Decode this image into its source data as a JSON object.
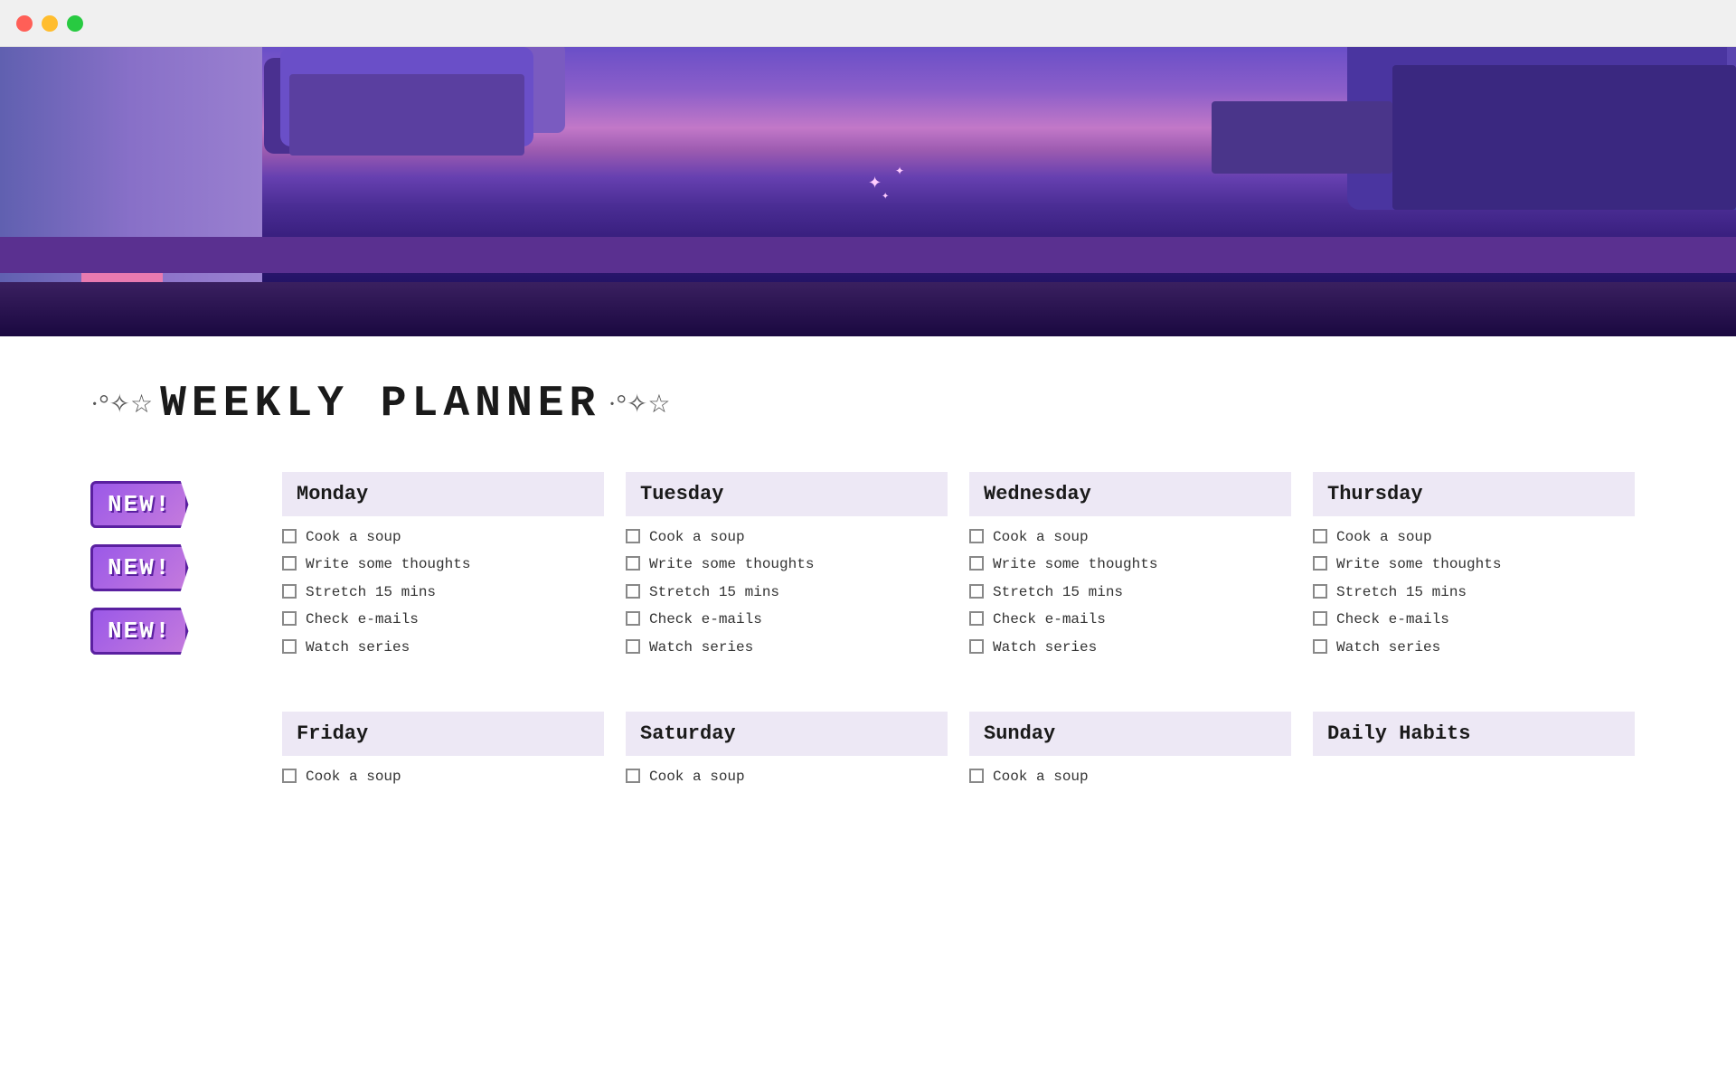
{
  "window": {
    "close_label": "close",
    "min_label": "minimize",
    "max_label": "maximize"
  },
  "title": {
    "deco_left": "·°✧☆",
    "main": "WEEKLY PLANNER",
    "deco_right": "·°✧☆"
  },
  "badges": [
    "NEW!",
    "NEW!",
    "NEW!"
  ],
  "days": [
    {
      "name": "Monday",
      "tasks": [
        "Cook a soup",
        "Write some thoughts",
        "Stretch 15 mins",
        "Check e-mails",
        "Watch series"
      ]
    },
    {
      "name": "Tuesday",
      "tasks": [
        "Cook a soup",
        "Write some thoughts",
        "Stretch 15 mins",
        "Check e-mails",
        "Watch series"
      ]
    },
    {
      "name": "Wednesday",
      "tasks": [
        "Cook a soup",
        "Write some thoughts",
        "Stretch 15 mins",
        "Check e-mails",
        "Watch series"
      ]
    },
    {
      "name": "Thursday",
      "tasks": [
        "Cook a soup",
        "Write some thoughts",
        "Stretch 15 mins",
        "Check e-mails",
        "Watch series"
      ]
    }
  ],
  "bottom_days": [
    {
      "name": "Friday",
      "tasks": [
        "Cook a soup"
      ]
    },
    {
      "name": "Saturday",
      "tasks": [
        "Cook a soup"
      ]
    },
    {
      "name": "Sunday",
      "tasks": [
        "Cook a soup"
      ]
    },
    {
      "name": "Daily Habits",
      "tasks": []
    }
  ]
}
